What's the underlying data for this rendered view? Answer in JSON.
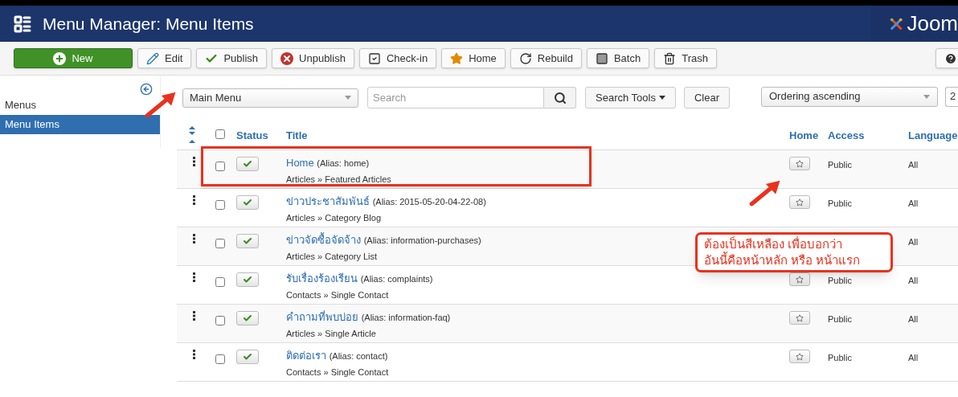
{
  "header": {
    "title": "Menu Manager: Menu Items",
    "logo_text": "Joom"
  },
  "toolbar": [
    {
      "label": "New",
      "kind": "new"
    },
    {
      "label": "Edit",
      "kind": "edit"
    },
    {
      "label": "Publish",
      "kind": "publish"
    },
    {
      "label": "Unpublish",
      "kind": "unpublish"
    },
    {
      "label": "Check-in",
      "kind": "checkin"
    },
    {
      "label": "Home",
      "kind": "home"
    },
    {
      "label": "Rebuild",
      "kind": "rebuild"
    },
    {
      "label": "Batch",
      "kind": "batch"
    },
    {
      "label": "Trash",
      "kind": "trash"
    },
    {
      "kind": "help"
    }
  ],
  "sidebar": {
    "items": [
      {
        "label": "Menus",
        "selected": false
      },
      {
        "label": "Menu Items",
        "selected": true
      }
    ]
  },
  "filters": {
    "menu_select": "Main Menu",
    "search": {
      "placeholder": "Search"
    },
    "search_tools": "Search Tools",
    "clear": "Clear",
    "ordering": "Ordering ascending",
    "limit": "2"
  },
  "table": {
    "select_all_checked": false,
    "columns": [
      "Status",
      "Title",
      "Home",
      "Access",
      "Language"
    ],
    "rows": [
      {
        "title": "Home",
        "alias": "(Alias: home)",
        "type": "Articles » Featured Articles",
        "published": true,
        "checked": false,
        "home": false,
        "access": "Public",
        "language": "All",
        "highlighted": true
      },
      {
        "title": "ข่าวประชาสัมพันธ์",
        "alias": "(Alias: 2015-05-20-04-22-08)",
        "type": "Articles » Category Blog",
        "published": true,
        "checked": false,
        "home": false,
        "access": "Public",
        "language": "All",
        "highlighted": false
      },
      {
        "title": "ข่าวจัดซื้อจัดจ้าง",
        "alias": "(Alias: information-purchases)",
        "type": "Articles » Category List",
        "published": true,
        "checked": false,
        "language": "All",
        "highlighted": false
      },
      {
        "title": "รับเรื่องร้องเรียน",
        "alias": "(Alias: complaints)",
        "type": "Contacts » Single Contact",
        "published": true,
        "checked": false,
        "home": false,
        "access": "Public",
        "language": "All",
        "highlighted": false
      },
      {
        "title": "คำถามที่พบบ่อย",
        "alias": "(Alias: information-faq)",
        "type": "Articles » Single Article",
        "published": true,
        "checked": false,
        "home": false,
        "access": "Public",
        "language": "All",
        "highlighted": false
      },
      {
        "title": "ติดต่อเรา",
        "alias": "(Alias: contact)",
        "type": "Contacts » Single Contact",
        "published": true,
        "checked": false,
        "home": false,
        "access": "Public",
        "language": "All",
        "highlighted": false
      }
    ]
  },
  "annotation": {
    "callout": [
      "ต้องเป็นสีเหลือง เพื่อบอกว่า",
      "อันนี้คือหน้าหลัก หรือ หน้าแรก"
    ]
  }
}
